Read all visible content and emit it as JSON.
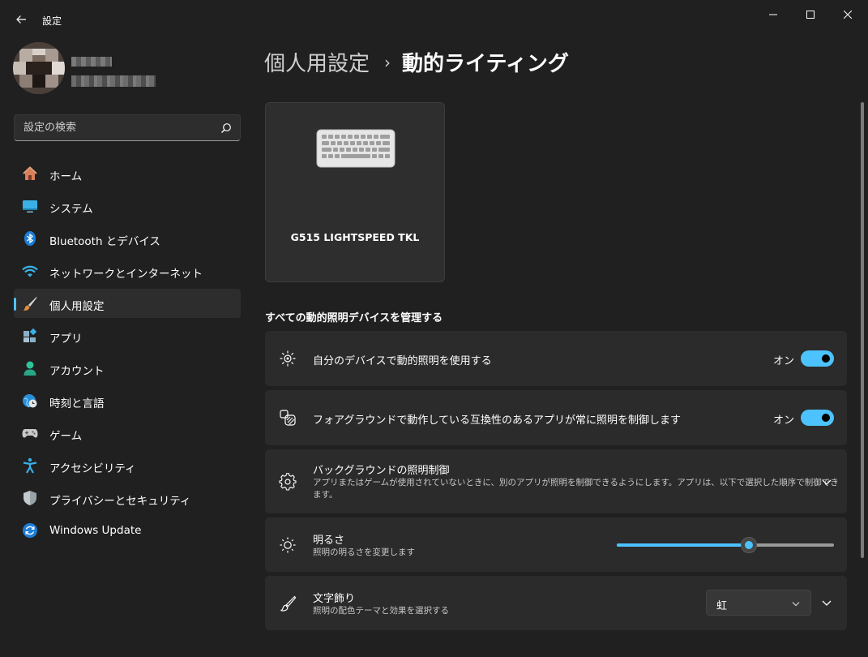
{
  "window": {
    "title": "設定"
  },
  "search": {
    "placeholder": "設定の検索"
  },
  "nav": {
    "items": [
      {
        "label": "ホーム"
      },
      {
        "label": "システム"
      },
      {
        "label": "Bluetooth とデバイス"
      },
      {
        "label": "ネットワークとインターネット"
      },
      {
        "label": "個人用設定"
      },
      {
        "label": "アプリ"
      },
      {
        "label": "アカウント"
      },
      {
        "label": "時刻と言語"
      },
      {
        "label": "ゲーム"
      },
      {
        "label": "アクセシビリティ"
      },
      {
        "label": "プライバシーとセキュリティ"
      },
      {
        "label": "Windows Update"
      }
    ],
    "active_index": 4
  },
  "header": {
    "parent": "個人用設定",
    "separator": "›",
    "current": "動的ライティング"
  },
  "device": {
    "name": "G515 LIGHTSPEED TKL",
    "icon": "keyboard-icon"
  },
  "section": {
    "title": "すべての動的照明デバイスを管理する"
  },
  "settings": {
    "use_dynamic_lighting": {
      "title": "自分のデバイスで動的照明を使用する",
      "state_label": "オン",
      "on": true
    },
    "foreground_control": {
      "title": "フォアグラウンドで動作している互換性のあるアプリが常に照明を制御します",
      "state_label": "オン",
      "on": true
    },
    "background_control": {
      "title": "バックグラウンドの照明制御",
      "desc_line1": "アプリまたはゲームが使用されていないときに、別のアプリが照明を制御できるようにします。アプリは、以下で選択した順序で制御でき",
      "desc_line2": "ます。"
    },
    "brightness": {
      "title": "明るさ",
      "desc": "照明の明るさを変更します",
      "value_percent": 61
    },
    "effects": {
      "title": "文字飾り",
      "desc": "照明の配色テーマと効果を選択する",
      "selected": "虹"
    }
  },
  "colors": {
    "accent": "#4cc2ff",
    "background": "#202020",
    "card": "#2b2b2b"
  }
}
